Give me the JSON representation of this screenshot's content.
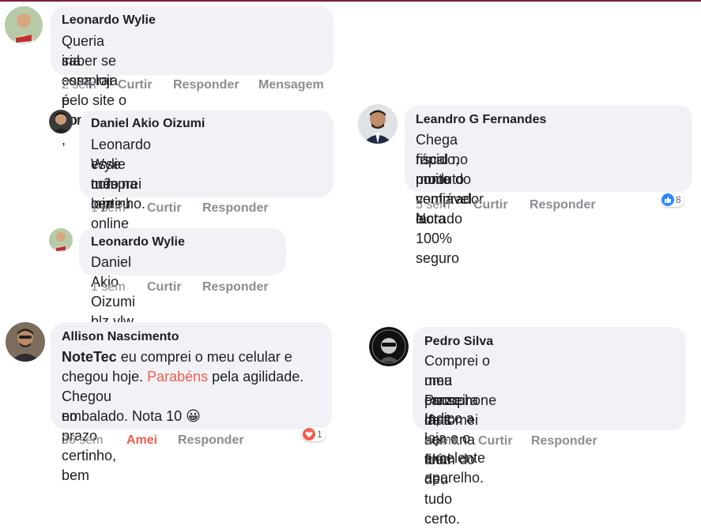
{
  "actions": {
    "like": "Curtir",
    "reply": "Responder",
    "message": "Mensagem",
    "loved": "Amei"
  },
  "comments": [
    {
      "author": "Leonardo Wylie",
      "lines": [
        "Queria saber se essa loja é confiável ,",
        "iria comprar pelo site o pocophone"
      ],
      "time": "2 sem"
    },
    {
      "author": "Daniel Akio Oizumi",
      "lines": [
        "Leonardo Wylie comprei o meu",
        "esse mês na loja online e chegou",
        "tudo certinho."
      ],
      "time": "1 sem"
    },
    {
      "author": "Leonardo Wylie",
      "lines": [
        "Daniel Akio Oizumi blz vlw"
      ],
      "time": "1 sem"
    },
    {
      "author": "Leandro G Fernandes",
      "lines": [
        "Chega rápido, muito confiável. Nota",
        "fiscal no nome do comprador e",
        "produto vem lacrado 100% seguro"
      ],
      "time": "5 sem",
      "reaction_count": "8"
    },
    {
      "author": "Allison Nascimento",
      "mention": "NoteTec",
      "line1_rest": " eu comprei o meu celular e",
      "line2_start": "chegou hoje. ",
      "highlight": "Parabéns",
      "line2_rest": " pela agilidade.",
      "line3": "Chegou no prazo certinho, bem",
      "line4": "embalado. Nota 10",
      "emoji": "😀",
      "time": "36 sem",
      "reaction_count": "1"
    },
    {
      "author": "Pedro Silva",
      "lines": [
        "Comprei o meu Pocophone lá, tomei",
        "uma canseira de 1 semana além do",
        "prazo mas no final deu tudo certo.",
        "Indico a loja e o excelente aparelho."
      ],
      "time": "4 sem"
    }
  ],
  "colors": {
    "bubble": "#f0f2f5",
    "meta": "#8a8d91",
    "love": "#f05e4e",
    "like": "#2d88ff",
    "topline": "#7a1f3d"
  }
}
